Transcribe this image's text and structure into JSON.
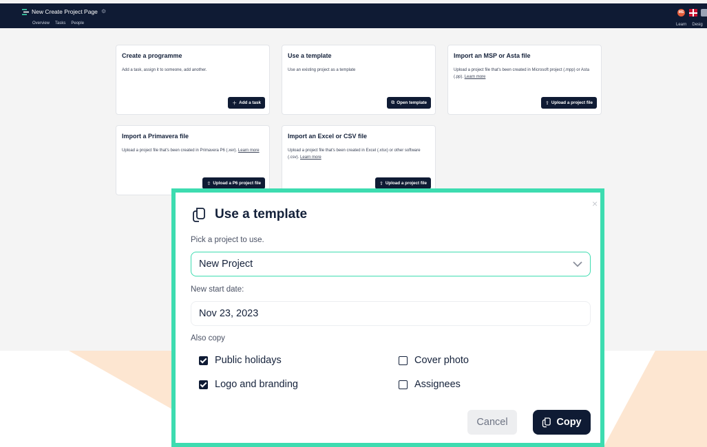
{
  "header": {
    "title": "New Create Project Page",
    "settings_icon": "gear-icon",
    "tabs": [
      "Overview",
      "Tasks",
      "People"
    ],
    "avatar_initials": "MS",
    "right_links": [
      "Learn",
      "Desig"
    ]
  },
  "cards": [
    {
      "title": "Create a programme",
      "description": "Add a task, assign it to someone, add another.",
      "link": "",
      "button": "Add a task",
      "button_icon": "plus-icon"
    },
    {
      "title": "Use a template",
      "description": "Use an existing project as a template",
      "link": "",
      "button": "Open template",
      "button_icon": "copy-icon"
    },
    {
      "title": "Import an MSP or Asta file",
      "description": "Upload a project file that's been created in Microsoft project (.mpp) or Asta (.pp).",
      "link": "Learn more",
      "button": "Upload a project file",
      "button_icon": "upload-icon"
    },
    {
      "title": "Import a Primavera file",
      "description": "Upload a project file that's been created in Primavera P6 (.xer).",
      "link": "Learn more",
      "button": "Upload a P6 project file",
      "button_icon": "upload-icon"
    },
    {
      "title": "Import an Excel or CSV file",
      "description": "Upload a project file that's been created in Excel (.xlsx) or other software (.csv).",
      "link": "Learn more",
      "button": "Upload a project file",
      "button_icon": "upload-icon"
    }
  ],
  "modal": {
    "title": "Use a template",
    "title_icon": "copy-icon",
    "close": "×",
    "project_label": "Pick a project to use.",
    "project_value": "New Project",
    "date_label": "New start date:",
    "date_value": "Nov 23, 2023",
    "also_copy_label": "Also copy",
    "options": [
      {
        "label": "Public holidays",
        "checked": true
      },
      {
        "label": "Cover photo",
        "checked": false
      },
      {
        "label": "Logo and branding",
        "checked": true
      },
      {
        "label": "Assignees",
        "checked": false
      }
    ],
    "cancel": "Cancel",
    "copy": "Copy"
  },
  "colors": {
    "navy": "#0f1b34",
    "accent": "#3ddcb0",
    "peach": "#fde8d6",
    "avatar": "#e35d3b"
  }
}
